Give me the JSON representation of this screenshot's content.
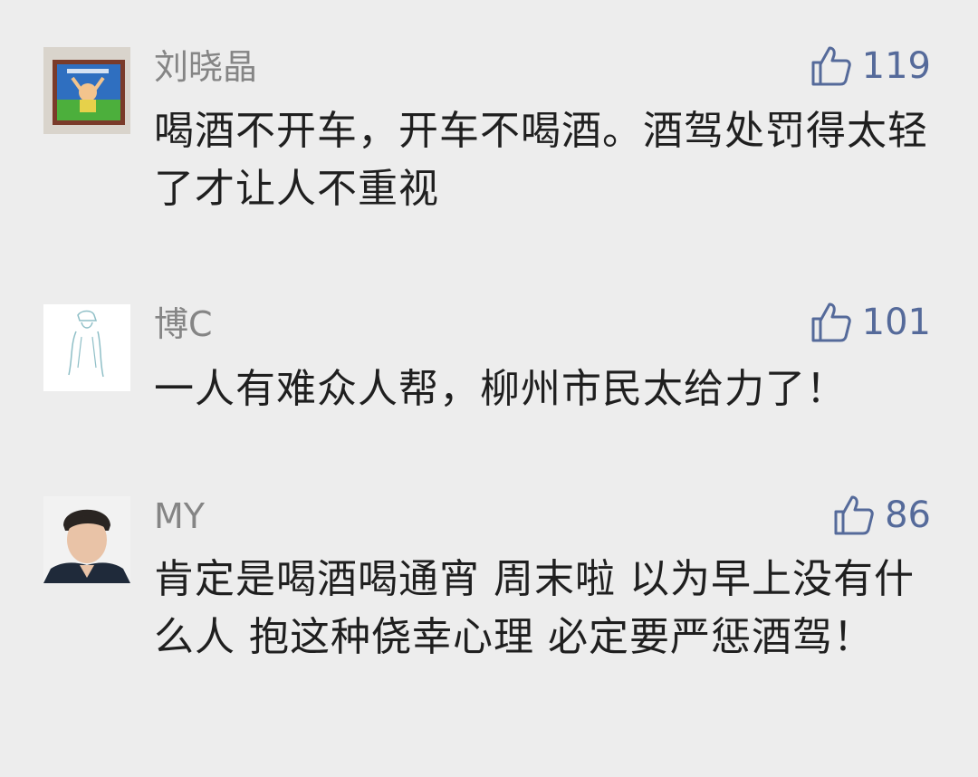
{
  "colors": {
    "background": "#ededed",
    "username": "#858585",
    "likes": "#556a9a",
    "text": "#1f1f1f"
  },
  "comments": [
    {
      "username": "刘晓晶",
      "avatar": "framed-child-drawing-avatar",
      "like_icon": "thumbs-up-icon",
      "likes": "119",
      "text": "喝酒不开车，开车不喝酒。酒驾处罚得太轻了才让人不重视"
    },
    {
      "username": "博C",
      "avatar": "sketch-figure-avatar",
      "like_icon": "thumbs-up-icon",
      "likes": "101",
      "text": "一人有难众人帮，柳州市民太给力了！"
    },
    {
      "username": "MY",
      "avatar": "young-man-photo-avatar",
      "like_icon": "thumbs-up-icon",
      "likes": "86",
      "text": "肯定是喝酒喝通宵 周末啦 以为早上没有什么人 抱这种侥幸心理 必定要严惩酒驾！"
    }
  ]
}
